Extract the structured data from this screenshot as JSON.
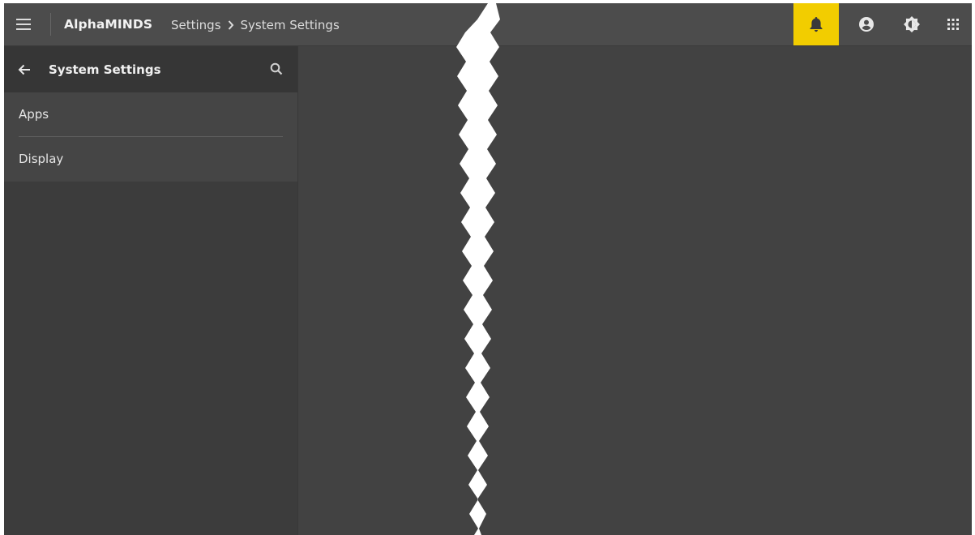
{
  "app": {
    "brand": "AlphaMINDS"
  },
  "breadcrumb": {
    "parent": "Settings",
    "current": "System Settings"
  },
  "topbar_icons": [
    {
      "name": "bell-icon",
      "active": true
    },
    {
      "name": "account-circle-icon",
      "active": false
    },
    {
      "name": "brightness-icon",
      "active": false
    },
    {
      "name": "apps-grid-icon",
      "active": false
    }
  ],
  "sidepanel": {
    "title": "System Settings",
    "items": [
      {
        "label": "Apps"
      },
      {
        "label": "Display"
      }
    ]
  },
  "colors": {
    "accent": "#f2cd00",
    "background": "#424242",
    "topbar": "#4c4c4c",
    "panel": "#3c3c3c"
  }
}
